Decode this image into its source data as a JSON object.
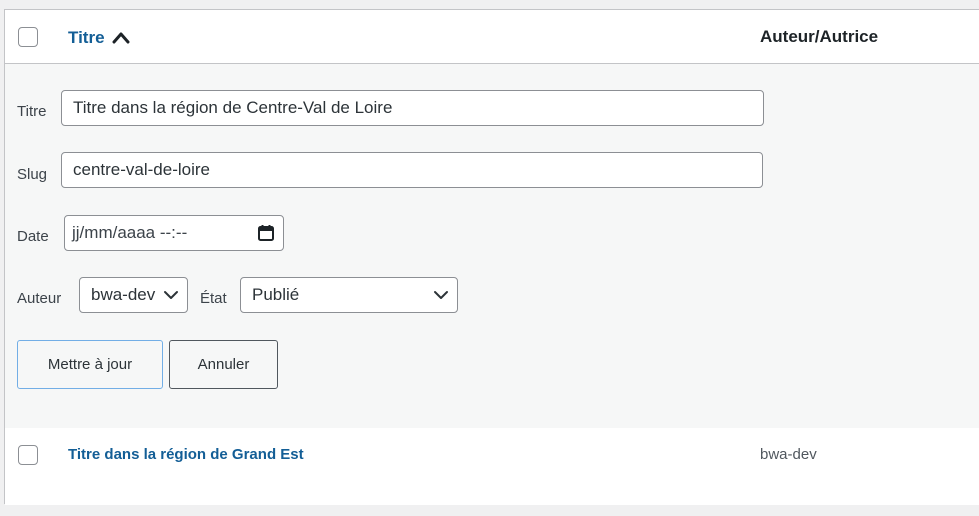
{
  "header": {
    "title_col": "Titre",
    "author_col": "Auteur/Autrice"
  },
  "quick_edit": {
    "title_label": "Titre",
    "title_value": "Titre dans la région de Centre-Val de Loire",
    "slug_label": "Slug",
    "slug_value": "centre-val-de-loire",
    "date_label": "Date",
    "date_placeholder": "jj/mm/aaaa --:--",
    "author_label": "Auteur",
    "author_value": "bwa-dev",
    "status_label": "État",
    "status_value": "Publié",
    "update_button": "Mettre à jour",
    "cancel_button": "Annuler"
  },
  "rows": [
    {
      "title": "Titre dans la région de Grand Est",
      "author": "bwa-dev"
    }
  ],
  "colors": {
    "link": "#135e96",
    "primary_border": "#72aee6",
    "background": "#f0f0f1",
    "edit_bg": "#f6f7f7"
  },
  "icons": {
    "sort": "chevron-up-icon",
    "select": "chevron-down-icon",
    "date": "calendar-icon"
  }
}
